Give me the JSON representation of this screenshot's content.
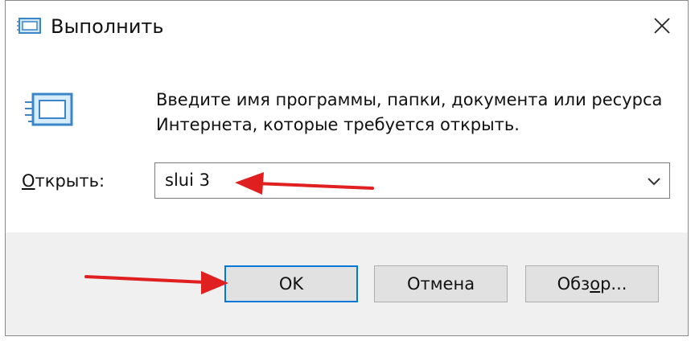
{
  "window": {
    "title": "Выполнить",
    "close_icon": "close-icon",
    "app_icon": "run-dialog-icon"
  },
  "content": {
    "description_line1": "Введите имя программы, папки, документа или ресурса",
    "description_line2": "Интернета, которые требуется открыть.",
    "open_label_accel": "О",
    "open_label_rest": "ткрыть:",
    "open_value": "slui 3",
    "dropdown_icon": "chevron-down-icon"
  },
  "buttons": {
    "ok": "OK",
    "cancel": "Отмена",
    "browse_pre": "Обз",
    "browse_accel": "о",
    "browse_post": "р..."
  },
  "annotations": {
    "arrow_color": "#e02020"
  },
  "colors": {
    "accent": "#0078d7",
    "footer_bg": "#f0f0f0",
    "button_bg": "#e1e1e1"
  }
}
